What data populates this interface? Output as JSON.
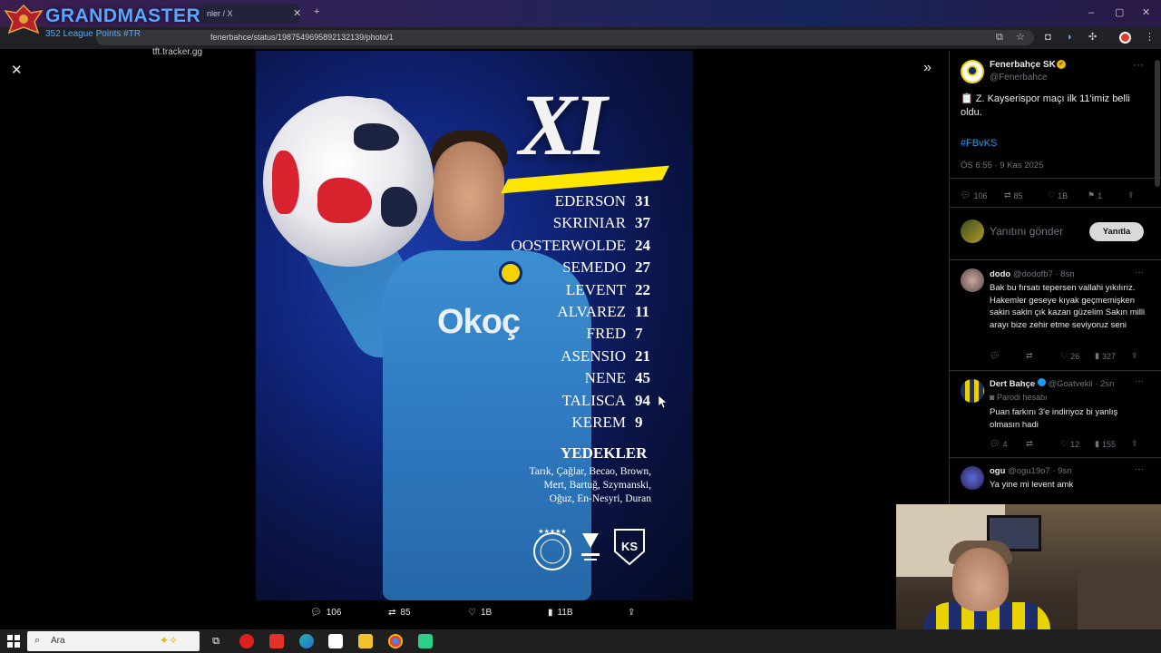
{
  "browser": {
    "tab_title": "nler / X",
    "url": "fenerbahce/status/1987549695892132139/photo/1",
    "new_tab": "+",
    "min": "–",
    "max": "▢",
    "close": "✕"
  },
  "overlay_badge": {
    "title": "GRANDMASTER",
    "subtitle": "352 League Points #TR",
    "site": "tft.tracker.gg"
  },
  "viewer": {
    "close_icon": "✕",
    "expand_icon": "»"
  },
  "photo": {
    "headline": "XI",
    "sponsor": "Okoç",
    "players": [
      {
        "name": "EDERSON",
        "number": "31"
      },
      {
        "name": "SKRINIAR",
        "number": "37"
      },
      {
        "name": "OOSTERWOLDE",
        "number": "24"
      },
      {
        "name": "SEMEDO",
        "number": "27"
      },
      {
        "name": "LEVENT",
        "number": "22"
      },
      {
        "name": "ALVAREZ",
        "number": "11"
      },
      {
        "name": "FRED",
        "number": "7"
      },
      {
        "name": "ASENSIO",
        "number": "21"
      },
      {
        "name": "NENE",
        "number": "45"
      },
      {
        "name": "TALISCA",
        "number": "94"
      },
      {
        "name": "KEREM",
        "number": "9"
      }
    ],
    "subs_title": "YEDEKLER",
    "subs_lines": [
      "Tarık, Çağlar, Becao, Brown,",
      "Mert, Bartuğ, Szymanski,",
      "Oğuz, En-Nesyri, Duran"
    ],
    "logo_ks": "KS"
  },
  "action_bar": {
    "replies": "106",
    "reposts": "85",
    "likes": "1B",
    "views": "11B"
  },
  "tweet": {
    "author": "Fenerbahçe SK",
    "handle": "@Fenerbahce",
    "text": "Z. Kayserispor maçı ilk 11'imiz belli oldu.",
    "hashtag": "#FBvKS",
    "timestamp": "ÖS 6:55 · 9 Kas 2025",
    "replies": "106",
    "reposts": "85",
    "likes": "1B",
    "bookmarks": "1",
    "reply_placeholder": "Yanıtını gönder",
    "reply_button": "Yanıtla"
  },
  "replies": [
    {
      "name": "dodo",
      "handle": "@dodofb7 · 8sn",
      "text": "Bak bu fırsatı tepersen vallahi yıkılırız. Hakemler geseye kıyak geçmemişken sakin sakin çık kazan güzelim Sakın milli arayı bize zehir etme  seviyoruz seni",
      "reposts": "",
      "likes": "26",
      "views": "327"
    },
    {
      "name": "Dert Bahçe",
      "handle": "@Goatvekil · 2sn",
      "parody": "Parodi hesabı",
      "text": "Puan farkını 3'e indiriyoz bi yanlış olmasın hadi",
      "replies": "4",
      "likes": "12",
      "views": "155"
    },
    {
      "name": "ogu",
      "handle": "@ogu19o7 · 9sn",
      "text": "Ya yine mi levent amk"
    }
  ],
  "taskbar": {
    "search_placeholder": "Ara"
  },
  "colors": {
    "accent": "#1d9bf0",
    "yellow": "#ffe600",
    "kit_blue": "#3c8fd0"
  }
}
